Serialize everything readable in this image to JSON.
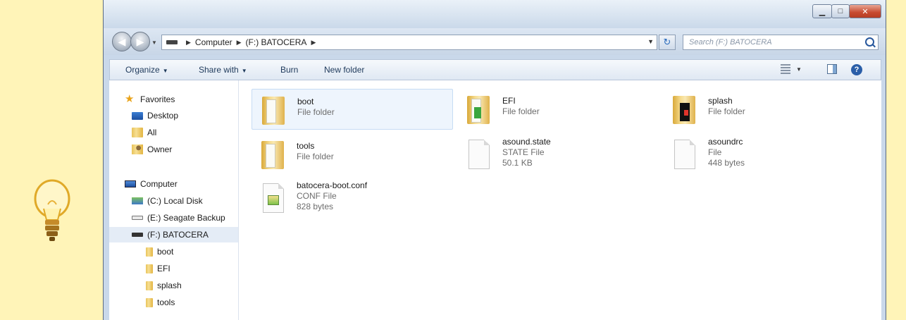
{
  "window": {
    "caption": {
      "minimize": "▁",
      "maximize": "□",
      "close": "✕"
    },
    "nav": {
      "back": "◀",
      "forward": "▶"
    }
  },
  "address": {
    "path": [
      "Computer",
      "(F:) BATOCERA"
    ],
    "search_placeholder": "Search (F:) BATOCERA"
  },
  "toolbar": {
    "organize": "Organize",
    "share_with": "Share with",
    "burn": "Burn",
    "new_folder": "New folder",
    "help": "?"
  },
  "sidebar": {
    "favorites_label": "Favorites",
    "favorites": [
      {
        "label": "Desktop",
        "icon": "desktop-icon"
      },
      {
        "label": "All",
        "icon": "folder-icon"
      },
      {
        "label": "Owner",
        "icon": "user-folder-icon"
      }
    ],
    "computer_label": "Computer",
    "drives": [
      {
        "label": "(C:) Local Disk",
        "icon": "local-disk-icon"
      },
      {
        "label": "(E:) Seagate Backup",
        "icon": "drive-icon"
      },
      {
        "label": "(F:) BATOCERA",
        "icon": "usb-drive-icon",
        "selected": true
      }
    ],
    "subfolders": [
      "boot",
      "EFI",
      "splash",
      "tools"
    ]
  },
  "files": [
    {
      "name": "boot",
      "type": "File folder",
      "size": "",
      "icon": "folder-icon"
    },
    {
      "name": "EFI",
      "type": "File folder",
      "size": "",
      "icon": "folder-icon"
    },
    {
      "name": "splash",
      "type": "File folder",
      "size": "",
      "icon": "folder-icon"
    },
    {
      "name": "tools",
      "type": "File folder",
      "size": "",
      "icon": "folder-icon"
    },
    {
      "name": "asound.state",
      "type": "STATE File",
      "size": "50.1 KB",
      "icon": "file-icon"
    },
    {
      "name": "asoundrc",
      "type": "File",
      "size": "448 bytes",
      "icon": "file-icon"
    },
    {
      "name": "batocera-boot.conf",
      "type": "CONF File",
      "size": "828 bytes",
      "icon": "conf-file-icon"
    }
  ]
}
